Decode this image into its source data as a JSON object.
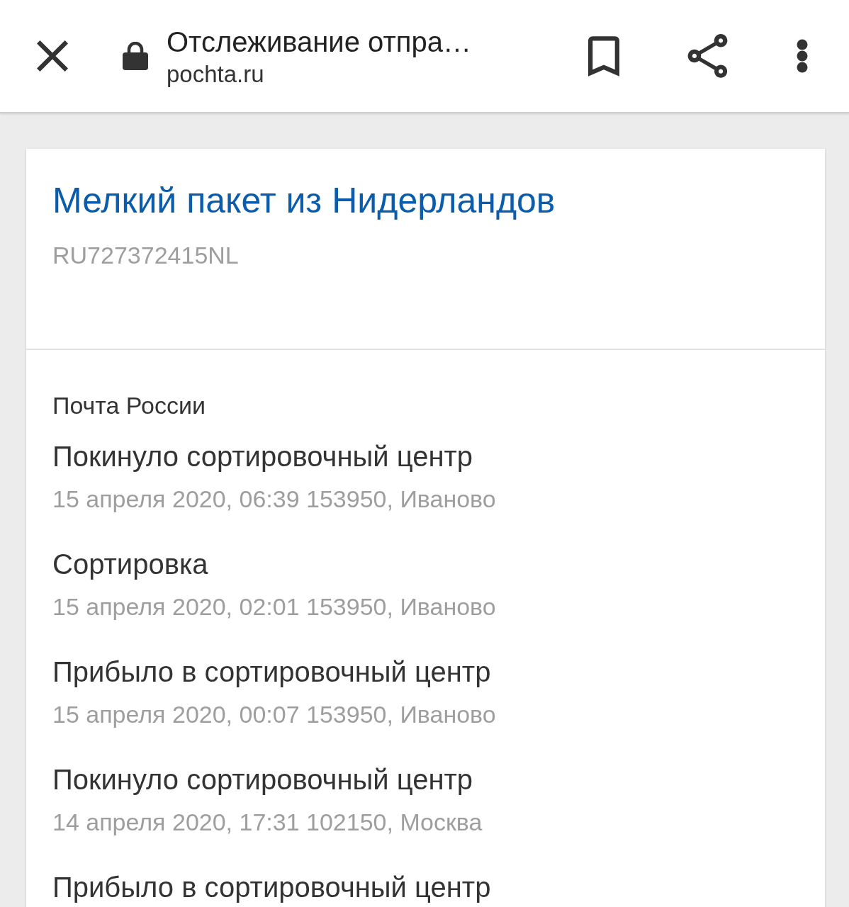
{
  "browser_bar": {
    "title": "Отслеживание отпра…",
    "url": "pochta.ru"
  },
  "parcel": {
    "title": "Мелкий пакет из Нидерландов",
    "tracking_number": "RU727372415NL"
  },
  "history": {
    "carrier": "Почта России",
    "events": [
      {
        "status": "Покинуло сортировочный центр",
        "details": "15 апреля 2020, 06:39 153950, Иваново"
      },
      {
        "status": "Сортировка",
        "details": "15 апреля 2020, 02:01 153950, Иваново"
      },
      {
        "status": "Прибыло в сортировочный центр",
        "details": "15 апреля 2020, 00:07 153950, Иваново"
      },
      {
        "status": "Покинуло сортировочный центр",
        "details": "14 апреля 2020, 17:31 102150, Москва"
      },
      {
        "status": "Прибыло в сортировочный центр"
      }
    ]
  }
}
